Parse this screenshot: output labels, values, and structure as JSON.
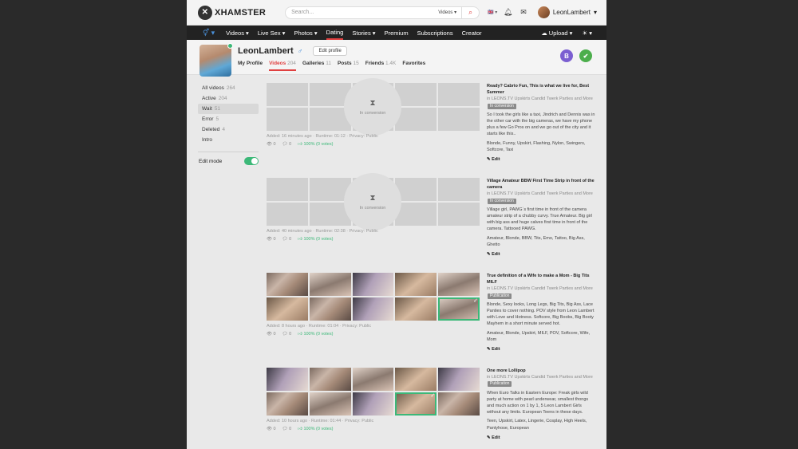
{
  "header": {
    "logo_text": "XHAMSTER",
    "search_placeholder": "Search...",
    "search_scope": "Videos",
    "user_name": "LeonLambert"
  },
  "nav": {
    "items": [
      {
        "label": "Videos",
        "has_menu": true
      },
      {
        "label": "Live Sex",
        "has_menu": true
      },
      {
        "label": "Photos",
        "has_menu": true
      },
      {
        "label": "Dating",
        "has_menu": false
      },
      {
        "label": "Stories",
        "has_menu": true
      },
      {
        "label": "Premium",
        "has_menu": false
      },
      {
        "label": "Subscriptions",
        "has_menu": false
      },
      {
        "label": "Creator",
        "has_menu": false
      }
    ],
    "upload_label": "Upload",
    "active": "Dating"
  },
  "profile": {
    "name": "LeonLambert",
    "edit_label": "Edit profile",
    "tabs": [
      {
        "label": "My Profile",
        "count": ""
      },
      {
        "label": "Videos",
        "count": "204"
      },
      {
        "label": "Galleries",
        "count": "11"
      },
      {
        "label": "Posts",
        "count": "15"
      },
      {
        "label": "Friends",
        "count": "1.4K"
      },
      {
        "label": "Favorites",
        "count": ""
      }
    ],
    "active_tab": "Videos"
  },
  "sidebar": {
    "items": [
      {
        "label": "All videos",
        "count": "264"
      },
      {
        "label": "Active",
        "count": "204"
      },
      {
        "label": "Wait",
        "count": "51"
      },
      {
        "label": "Error",
        "count": "5"
      },
      {
        "label": "Deleted",
        "count": "4"
      },
      {
        "label": "Intro",
        "count": ""
      }
    ],
    "active": "Wait",
    "edit_mode_label": "Edit mode",
    "edit_mode_on": true
  },
  "videos": [
    {
      "state": "conversion",
      "conversion_label": "In conversion",
      "meta": "Added: 16 minutes ago · Runtime: 01:12 · Privacy: Public",
      "views": "0",
      "comments": "0",
      "rating": "100% (0 votes)",
      "title": "Ready? Cabrio Fun, This is what we live for, Best Summer",
      "in_prefix": "in",
      "channel": "LEONS.TV Upskirts Candid Twerk Parties and More",
      "status": "In conversion",
      "description": "So I took the girls like a taxi, Jindrich and Dennis was in the other car with the big cameras, we have my phone plus a few Go Pros on and we go out of the city and it starts like this..",
      "tags": "Blonde, Funny, Upskirt, Flashing, Nylon, Swingers, Softcore, Taxi",
      "edit_label": "Edit"
    },
    {
      "state": "conversion",
      "conversion_label": "In conversion",
      "meta": "Added: 40 minutes ago · Runtime: 02:38 · Privacy: Public",
      "views": "0",
      "comments": "0",
      "rating": "100% (0 votes)",
      "title": "Village Amateur BBW First Time Strip in front of the camera",
      "in_prefix": "in",
      "channel": "LEONS.TV Upskirts Candid Twerk Parties and More",
      "status": "In conversion",
      "description": "Village girl, PAWG´s first time in front of the camera amateur strip of a chubby curvy. True Amateur. Big girl with big ass and huge calves first time in front of the camera. Tattooed PAWG.",
      "tags": "Amateur, Blonde, BBW, Tits, Emo, Tattoo, Big Ass, Ghetto",
      "edit_label": "Edit"
    },
    {
      "state": "ready",
      "meta": "Added: 8 hours ago · Runtime: 01:04 · Privacy: Public",
      "views": "0",
      "comments": "0",
      "rating": "100% (0 votes)",
      "title": "True definition of a Wife to make a Mom - Big Tits MILF",
      "in_prefix": "in",
      "channel": "LEONS.TV Upskirts Candid Twerk Parties and More",
      "status": "Publication",
      "description": "Blonde, Sexy looks, Long Legs, Big Tits, Big Ass, Lace Panties to cover nothing. POV style from Leon Lambert with Love and Hotness. Softcore, Big Boobs, Big Booty Mayhem in a short minute served hot.",
      "tags": "Amateur, Blonde, Upskirt, MILF, POV, Softcore, Wife, Mom",
      "edit_label": "Edit"
    },
    {
      "state": "ready",
      "meta": "Added: 10 hours ago · Runtime: 01:44 · Privacy: Public",
      "views": "0",
      "comments": "0",
      "rating": "100% (0 votes)",
      "title": "One more Lollipop",
      "in_prefix": "in",
      "channel": "LEONS.TV Upskirts Candid Twerk Parties and More",
      "status": "Publication",
      "description": "When Euro Talks in Eastern Europe: Freak girls wild party at home with pearl underwear, smallest thongs and much action on 1 by 1, 5 Leon Lambert Girls without any limits. European Teens in these days.",
      "tags": "Teen, Upskirt, Latex, Lingerie, Cosplay, High Heels, Pantyhose, European",
      "edit_label": "Edit"
    }
  ]
}
